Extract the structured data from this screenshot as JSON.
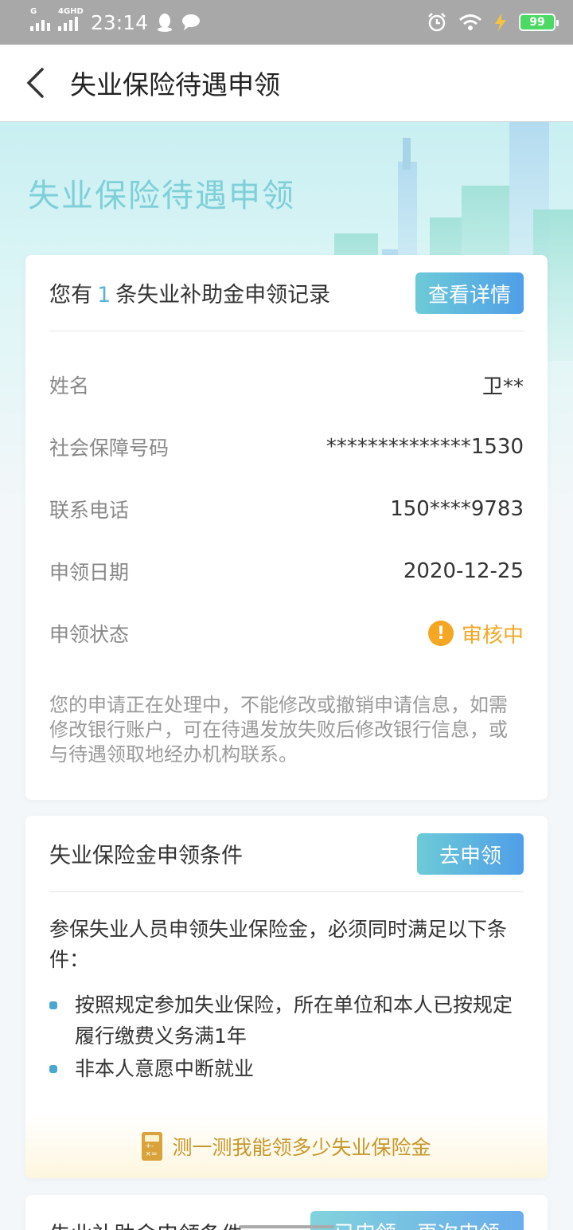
{
  "status_bar": {
    "network_1": "G",
    "network_2": "4GHD",
    "time": "23:14",
    "battery": "99",
    "icons": [
      "qq-icon",
      "message-icon",
      "alarm-icon",
      "wifi-icon",
      "charging-icon"
    ]
  },
  "navbar": {
    "back_icon": "chevron-left-icon",
    "title": "失业保险待遇申领"
  },
  "hero": {
    "title": "失业保险待遇申领"
  },
  "record_card": {
    "prefix": "您有",
    "count": "1",
    "suffix": "条失业补助金申领记录",
    "button": "查看详情",
    "rows": [
      {
        "label": "姓名",
        "value": "卫**"
      },
      {
        "label": "社会保障号码",
        "value": "**************1530"
      },
      {
        "label": "联系电话",
        "value": "150****9783"
      },
      {
        "label": "申领日期",
        "value": "2020-12-25"
      },
      {
        "label": "申领状态",
        "value": "审核中"
      }
    ],
    "note": "您的申请正在处理中，不能修改或撤销申请信息，如需修改银行账户，可在待遇发放失败后修改银行信息，或与待遇领取地经办机构联系。"
  },
  "conditions_card": {
    "title": "失业保险金申领条件",
    "button": "去申领",
    "intro": "参保失业人员申领失业保险金，必须同时满足以下条件：",
    "items": [
      "按照规定参加失业保险，所在单位和本人已按规定履行缴费义务满1年",
      "非本人意愿中断就业"
    ],
    "calc_link": "测一测我能领多少失业保险金"
  },
  "subsidy_card": {
    "title": "失业补助金申领条件",
    "button": "已申领，再次申领"
  },
  "colors": {
    "accent_blue": "#4f9ee8",
    "accent_teal": "#6ccbd7",
    "status_orange": "#f5a623",
    "link_gold": "#c8962a"
  }
}
